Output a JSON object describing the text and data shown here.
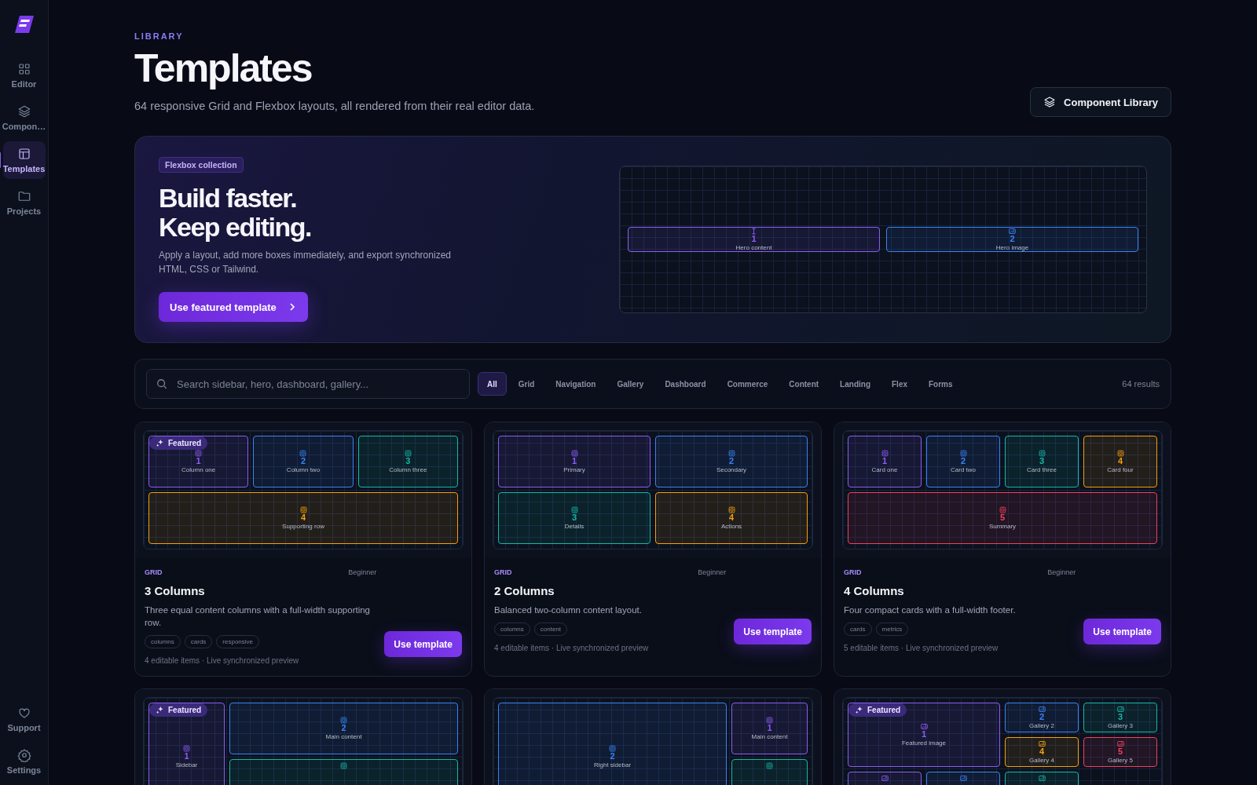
{
  "sidebar": {
    "items": [
      {
        "label": "Editor",
        "selected": false
      },
      {
        "label": "Compon…",
        "selected": false
      },
      {
        "label": "Templates",
        "selected": true
      },
      {
        "label": "Projects",
        "selected": false
      }
    ],
    "footer_items": [
      {
        "label": "Support"
      },
      {
        "label": "Settings"
      }
    ]
  },
  "header": {
    "eyebrow": "LIBRARY",
    "title": "Templates",
    "subtitle": "64 responsive Grid and Flexbox layouts, all rendered from their real editor data.",
    "action": "Component Library"
  },
  "hero": {
    "badge": "Flexbox collection",
    "headline": [
      "Build faster.",
      "Keep editing."
    ],
    "description": "Apply a layout, add more boxes immediately, and export synchronized HTML, CSS or Tailwind.",
    "button": "Use featured template",
    "preview": {
      "cells": [
        {
          "kind": "text",
          "number": "1",
          "label": "Hero content",
          "color": "#8b5cf6"
        },
        {
          "kind": "image",
          "number": "2",
          "label": "Hero image",
          "color": "#3b82f6"
        }
      ]
    }
  },
  "filters": {
    "search_placeholder": "Search sidebar, hero, dashboard, gallery...",
    "chips": [
      {
        "label": "All",
        "selected": true
      },
      {
        "label": "Grid",
        "selected": false
      },
      {
        "label": "Navigation",
        "selected": false
      },
      {
        "label": "Gallery",
        "selected": false
      },
      {
        "label": "Dashboard",
        "selected": false
      },
      {
        "label": "Commerce",
        "selected": false
      },
      {
        "label": "Content",
        "selected": false
      },
      {
        "label": "Landing",
        "selected": false
      },
      {
        "label": "Flex",
        "selected": false
      },
      {
        "label": "Forms",
        "selected": false
      }
    ],
    "result_count": "64 results"
  },
  "templates": [
    {
      "badge": "Featured",
      "category": "GRID",
      "level": "Beginner",
      "title": "3 Columns",
      "description": "Three equal content columns with a full-width supporting row.",
      "tags": [
        "columns",
        "cards",
        "responsive"
      ],
      "meta": "4 editable items · Live synchronized preview",
      "button": "Use template",
      "preview": {
        "cells": [
          {
            "kind": "box",
            "number": "1",
            "label": "Column one",
            "color": "#8b5cf6"
          },
          {
            "kind": "box",
            "number": "2",
            "label": "Column two",
            "color": "#3b82f6"
          },
          {
            "kind": "box",
            "number": "3",
            "label": "Column three",
            "color": "#14b8a6"
          },
          {
            "kind": "box",
            "number": "4",
            "label": "Supporting row",
            "color": "#f59e0b"
          }
        ]
      }
    },
    {
      "category": "GRID",
      "level": "Beginner",
      "title": "2 Columns",
      "description": "Balanced two-column content layout.",
      "tags": [
        "columns",
        "content"
      ],
      "meta": "4 editable items · Live synchronized preview",
      "button": "Use template",
      "preview": {
        "cells": [
          {
            "kind": "box",
            "number": "1",
            "label": "Primary",
            "color": "#8b5cf6"
          },
          {
            "kind": "box",
            "number": "2",
            "label": "Secondary",
            "color": "#3b82f6"
          },
          {
            "kind": "box",
            "number": "3",
            "label": "Details",
            "color": "#14b8a6"
          },
          {
            "kind": "box",
            "number": "4",
            "label": "Actions",
            "color": "#f59e0b"
          }
        ]
      }
    },
    {
      "category": "GRID",
      "level": "Beginner",
      "title": "4 Columns",
      "description": "Four compact cards with a full-width footer.",
      "tags": [
        "cards",
        "metrics"
      ],
      "meta": "5 editable items · Live synchronized preview",
      "button": "Use template",
      "preview": {
        "cells": [
          {
            "kind": "box",
            "number": "1",
            "label": "Card one",
            "color": "#8b5cf6"
          },
          {
            "kind": "box",
            "number": "2",
            "label": "Card two",
            "color": "#3b82f6"
          },
          {
            "kind": "box",
            "number": "3",
            "label": "Card three",
            "color": "#14b8a6"
          },
          {
            "kind": "box",
            "number": "4",
            "label": "Card four",
            "color": "#f59e0b"
          },
          {
            "kind": "box",
            "number": "5",
            "label": "Summary",
            "color": "#f43f5e"
          }
        ]
      }
    },
    {
      "badge": "Featured",
      "preview": {
        "cells": [
          {
            "kind": "box",
            "number": "1",
            "label": "Sidebar",
            "color": "#8b5cf6"
          },
          {
            "kind": "box",
            "number": "2",
            "label": "Main content",
            "color": "#3b82f6"
          },
          {
            "kind": "box",
            "color": "#14b8a6"
          }
        ]
      }
    },
    {
      "preview": {
        "cells": [
          {
            "kind": "box",
            "number": "1",
            "label": "Main content",
            "color": "#8b5cf6"
          },
          {
            "kind": "box",
            "number": "2",
            "label": "Right sidebar",
            "color": "#3b82f6"
          },
          {
            "kind": "box",
            "color": "#14b8a6"
          }
        ]
      }
    },
    {
      "badge": "Featured",
      "preview": {
        "cells": [
          {
            "kind": "image",
            "number": "1",
            "label": "Featured image",
            "color": "#8b5cf6"
          },
          {
            "kind": "image",
            "number": "2",
            "label": "Gallery 2",
            "color": "#3b82f6"
          },
          {
            "kind": "image",
            "number": "3",
            "label": "Gallery 3",
            "color": "#14b8a6"
          },
          {
            "kind": "image",
            "number": "4",
            "label": "Gallery 4",
            "color": "#f59e0b"
          },
          {
            "kind": "image",
            "number": "5",
            "label": "Gallery 5",
            "color": "#f43f5e"
          },
          {
            "kind": "image",
            "color": "#8b5cf6"
          },
          {
            "kind": "image",
            "color": "#3b82f6"
          },
          {
            "kind": "image",
            "color": "#14b8a6"
          }
        ]
      }
    }
  ]
}
